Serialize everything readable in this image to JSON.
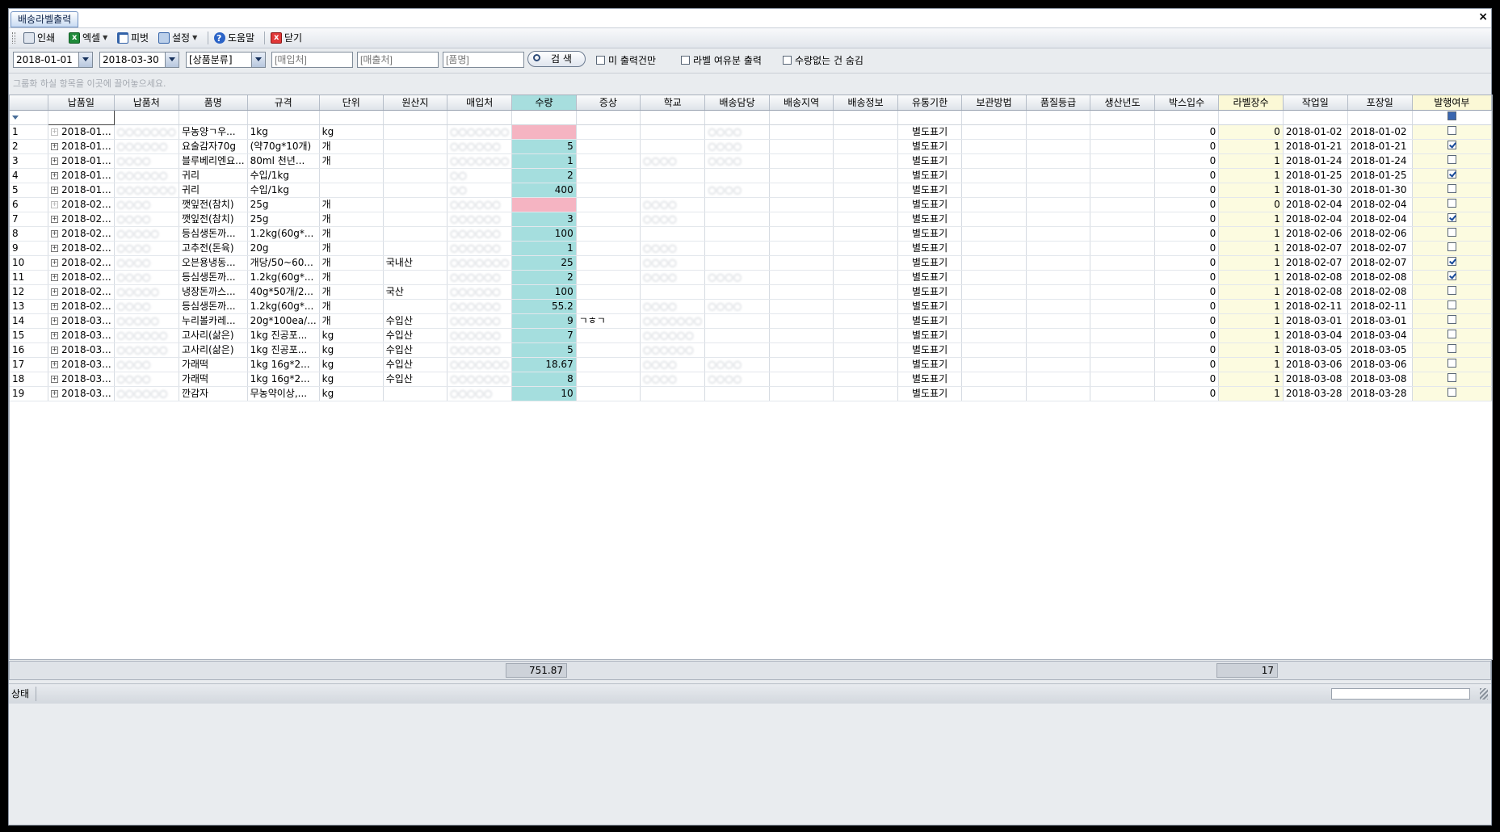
{
  "window": {
    "tab_title": "배송라벨출력",
    "close_glyph": "×"
  },
  "toolbar": {
    "print": "인쇄",
    "excel": "엑셀",
    "pivot": "피벗",
    "settings": "설정",
    "help": "도움말",
    "close": "닫기"
  },
  "filters": {
    "date_from": "2018-01-01",
    "date_to": "2018-03-30",
    "category": "[상품분류]",
    "supplier_placeholder": "[매입처]",
    "customer_placeholder": "[매출처]",
    "item_placeholder": "[품명]",
    "search_label": "검  색",
    "unprinted_only": {
      "label": "미 출력건만",
      "checked": false
    },
    "surplus_print": {
      "label": "라벨 여유분 출력",
      "checked": false
    },
    "hide_no_qty": {
      "label": "수량없는 건 숨김",
      "checked": false
    }
  },
  "group_panel_hint": "그룹화 하실 항목을 이곳에 끌어놓으세요.",
  "grid": {
    "columns": [
      "",
      "납품일",
      "납품처",
      "품명",
      "규격",
      "단위",
      "원산지",
      "매입처",
      "수량",
      "증상",
      "학교",
      "배송담당",
      "배송지역",
      "배송정보",
      "유통기한",
      "보관방법",
      "품질등급",
      "생산년도",
      "박스입수",
      "라벨장수",
      "작업일",
      "포장일",
      "발행여부"
    ],
    "rows": [
      {
        "n": "1",
        "date": "2018-01...",
        "cust": "○○○○○○○",
        "item": "무농양ㄱ우...",
        "spec": "1kg",
        "unit": "kg",
        "origin": "",
        "supplier": "○○○○○○○",
        "qty": "",
        "sym": "",
        "school": "",
        "mgr": "○○○○",
        "area": "",
        "info": "",
        "exp": "별도표기",
        "store": "",
        "grade": "",
        "year": "",
        "box": "0",
        "labels": "0",
        "work": "2018-01-02",
        "pack": "2018-01-02",
        "issued": false,
        "faint": true
      },
      {
        "n": "2",
        "date": "2018-01...",
        "cust": "○○○○○○",
        "item": "요술감자70g",
        "spec": "(약70g*10개)",
        "unit": "개",
        "origin": "",
        "supplier": "○○○○○○",
        "qty": "5",
        "sym": "",
        "school": "",
        "mgr": "○○○○",
        "area": "",
        "info": "",
        "exp": "별도표기",
        "store": "",
        "grade": "",
        "year": "",
        "box": "0",
        "labels": "1",
        "work": "2018-01-21",
        "pack": "2018-01-21",
        "issued": true,
        "faint": false
      },
      {
        "n": "3",
        "date": "2018-01...",
        "cust": "○○○○",
        "item": "블루베리엔요...",
        "spec": "80ml 천년...",
        "unit": "개",
        "origin": "",
        "supplier": "○○○○○○○",
        "qty": "1",
        "sym": "",
        "school": "○○○○",
        "mgr": "○○○○",
        "area": "",
        "info": "",
        "exp": "별도표기",
        "store": "",
        "grade": "",
        "year": "",
        "box": "0",
        "labels": "1",
        "work": "2018-01-24",
        "pack": "2018-01-24",
        "issued": false,
        "faint": false
      },
      {
        "n": "4",
        "date": "2018-01...",
        "cust": "○○○○○○",
        "item": "귀리",
        "spec": "수입/1kg",
        "unit": "",
        "origin": "",
        "supplier": "○○",
        "qty": "2",
        "sym": "",
        "school": "",
        "mgr": "",
        "area": "",
        "info": "",
        "exp": "별도표기",
        "store": "",
        "grade": "",
        "year": "",
        "box": "0",
        "labels": "1",
        "work": "2018-01-25",
        "pack": "2018-01-25",
        "issued": true,
        "faint": false
      },
      {
        "n": "5",
        "date": "2018-01...",
        "cust": "○○○○○○○",
        "item": "귀리",
        "spec": "수입/1kg",
        "unit": "",
        "origin": "",
        "supplier": "○○",
        "qty": "400",
        "sym": "",
        "school": "",
        "mgr": "○○○○",
        "area": "",
        "info": "",
        "exp": "별도표기",
        "store": "",
        "grade": "",
        "year": "",
        "box": "0",
        "labels": "1",
        "work": "2018-01-30",
        "pack": "2018-01-30",
        "issued": false,
        "faint": false
      },
      {
        "n": "6",
        "date": "2018-02...",
        "cust": "○○○○",
        "item": "깻잎전(참치)",
        "spec": "25g",
        "unit": "개",
        "origin": "",
        "supplier": "○○○○○○",
        "qty": "",
        "sym": "",
        "school": "○○○○",
        "mgr": "",
        "area": "",
        "info": "",
        "exp": "별도표기",
        "store": "",
        "grade": "",
        "year": "",
        "box": "0",
        "labels": "0",
        "work": "2018-02-04",
        "pack": "2018-02-04",
        "issued": false,
        "faint": true
      },
      {
        "n": "7",
        "date": "2018-02...",
        "cust": "○○○○",
        "item": "깻잎전(참치)",
        "spec": "25g",
        "unit": "개",
        "origin": "",
        "supplier": "○○○○○○",
        "qty": "3",
        "sym": "",
        "school": "○○○○",
        "mgr": "",
        "area": "",
        "info": "",
        "exp": "별도표기",
        "store": "",
        "grade": "",
        "year": "",
        "box": "0",
        "labels": "1",
        "work": "2018-02-04",
        "pack": "2018-02-04",
        "issued": true,
        "faint": false
      },
      {
        "n": "8",
        "date": "2018-02...",
        "cust": "○○○○○",
        "item": "등심생돈까...",
        "spec": "1.2kg(60g*...",
        "unit": "개",
        "origin": "",
        "supplier": "○○○○○○",
        "qty": "100",
        "sym": "",
        "school": "",
        "mgr": "",
        "area": "",
        "info": "",
        "exp": "별도표기",
        "store": "",
        "grade": "",
        "year": "",
        "box": "0",
        "labels": "1",
        "work": "2018-02-06",
        "pack": "2018-02-06",
        "issued": false,
        "faint": false
      },
      {
        "n": "9",
        "date": "2018-02...",
        "cust": "○○○○",
        "item": "고추전(돈육)",
        "spec": "20g",
        "unit": "개",
        "origin": "",
        "supplier": "○○○○○○",
        "qty": "1",
        "sym": "",
        "school": "○○○○",
        "mgr": "",
        "area": "",
        "info": "",
        "exp": "별도표기",
        "store": "",
        "grade": "",
        "year": "",
        "box": "0",
        "labels": "1",
        "work": "2018-02-07",
        "pack": "2018-02-07",
        "issued": false,
        "faint": false
      },
      {
        "n": "10",
        "date": "2018-02...",
        "cust": "○○○○",
        "item": "오븐용냉동...",
        "spec": "개당/50~60...",
        "unit": "개",
        "origin": "국내산",
        "supplier": "○○○○○○○",
        "qty": "25",
        "sym": "",
        "school": "○○○○",
        "mgr": "",
        "area": "",
        "info": "",
        "exp": "별도표기",
        "store": "",
        "grade": "",
        "year": "",
        "box": "0",
        "labels": "1",
        "work": "2018-02-07",
        "pack": "2018-02-07",
        "issued": true,
        "faint": false
      },
      {
        "n": "11",
        "date": "2018-02...",
        "cust": "○○○○",
        "item": "등심생돈까...",
        "spec": "1.2kg(60g*...",
        "unit": "개",
        "origin": "",
        "supplier": "○○○○○○",
        "qty": "2",
        "sym": "",
        "school": "○○○○",
        "mgr": "○○○○",
        "area": "",
        "info": "",
        "exp": "별도표기",
        "store": "",
        "grade": "",
        "year": "",
        "box": "0",
        "labels": "1",
        "work": "2018-02-08",
        "pack": "2018-02-08",
        "issued": true,
        "faint": false
      },
      {
        "n": "12",
        "date": "2018-02...",
        "cust": "○○○○○",
        "item": "냉장돈까스...",
        "spec": "40g*50개/2...",
        "unit": "개",
        "origin": "국산",
        "supplier": "○○○○○○",
        "qty": "100",
        "sym": "",
        "school": "",
        "mgr": "",
        "area": "",
        "info": "",
        "exp": "별도표기",
        "store": "",
        "grade": "",
        "year": "",
        "box": "0",
        "labels": "1",
        "work": "2018-02-08",
        "pack": "2018-02-08",
        "issued": false,
        "faint": false
      },
      {
        "n": "13",
        "date": "2018-02...",
        "cust": "○○○○",
        "item": "등심생돈까...",
        "spec": "1.2kg(60g*...",
        "unit": "개",
        "origin": "",
        "supplier": "○○○○○○",
        "qty": "55.2",
        "sym": "",
        "school": "○○○○",
        "mgr": "○○○○",
        "area": "",
        "info": "",
        "exp": "별도표기",
        "store": "",
        "grade": "",
        "year": "",
        "box": "0",
        "labels": "1",
        "work": "2018-02-11",
        "pack": "2018-02-11",
        "issued": false,
        "faint": false
      },
      {
        "n": "14",
        "date": "2018-03...",
        "cust": "○○○○○",
        "item": "누리볼카레...",
        "spec": "20g*100ea/...",
        "unit": "개",
        "origin": "수입산",
        "supplier": "○○○○○○",
        "qty": "9",
        "sym": "ㄱㅎㄱ",
        "school": "○○○○○○○",
        "mgr": "",
        "area": "",
        "info": "",
        "exp": "별도표기",
        "store": "",
        "grade": "",
        "year": "",
        "box": "0",
        "labels": "1",
        "work": "2018-03-01",
        "pack": "2018-03-01",
        "issued": false,
        "faint": false
      },
      {
        "n": "15",
        "date": "2018-03...",
        "cust": "○○○○○○",
        "item": "고사리(삶은)",
        "spec": "1kg 진공포...",
        "unit": "kg",
        "origin": "수입산",
        "supplier": "○○○○○○",
        "qty": "7",
        "sym": "",
        "school": "○○○○○○",
        "mgr": "",
        "area": "",
        "info": "",
        "exp": "별도표기",
        "store": "",
        "grade": "",
        "year": "",
        "box": "0",
        "labels": "1",
        "work": "2018-03-04",
        "pack": "2018-03-04",
        "issued": false,
        "faint": false
      },
      {
        "n": "16",
        "date": "2018-03...",
        "cust": "○○○○○○",
        "item": "고사리(삶은)",
        "spec": "1kg 진공포...",
        "unit": "kg",
        "origin": "수입산",
        "supplier": "○○○○○○",
        "qty": "5",
        "sym": "",
        "school": "○○○○○○",
        "mgr": "",
        "area": "",
        "info": "",
        "exp": "별도표기",
        "store": "",
        "grade": "",
        "year": "",
        "box": "0",
        "labels": "1",
        "work": "2018-03-05",
        "pack": "2018-03-05",
        "issued": false,
        "faint": false
      },
      {
        "n": "17",
        "date": "2018-03...",
        "cust": "○○○○",
        "item": "가래떡",
        "spec": "1kg 16g*2...",
        "unit": "kg",
        "origin": "수입산",
        "supplier": "○○○○○○○",
        "qty": "18.67",
        "sym": "",
        "school": "○○○○",
        "mgr": "○○○○",
        "area": "",
        "info": "",
        "exp": "별도표기",
        "store": "",
        "grade": "",
        "year": "",
        "box": "0",
        "labels": "1",
        "work": "2018-03-06",
        "pack": "2018-03-06",
        "issued": false,
        "faint": false
      },
      {
        "n": "18",
        "date": "2018-03...",
        "cust": "○○○○",
        "item": "가래떡",
        "spec": "1kg 16g*2...",
        "unit": "kg",
        "origin": "수입산",
        "supplier": "○○○○○○○",
        "qty": "8",
        "sym": "",
        "school": "○○○○",
        "mgr": "○○○○",
        "area": "",
        "info": "",
        "exp": "별도표기",
        "store": "",
        "grade": "",
        "year": "",
        "box": "0",
        "labels": "1",
        "work": "2018-03-08",
        "pack": "2018-03-08",
        "issued": false,
        "faint": false
      },
      {
        "n": "19",
        "date": "2018-03...",
        "cust": "○○○○○○",
        "item": "깐감자",
        "spec": "무농약이상,...",
        "unit": "kg",
        "origin": "",
        "supplier": "○○○○○",
        "qty": "10",
        "sym": "",
        "school": "",
        "mgr": "",
        "area": "",
        "info": "",
        "exp": "별도표기",
        "store": "",
        "grade": "",
        "year": "",
        "box": "0",
        "labels": "1",
        "work": "2018-03-28",
        "pack": "2018-03-28",
        "issued": false,
        "faint": false
      }
    ]
  },
  "summary": {
    "qty_total": "751.87",
    "label_total": "17"
  },
  "status": {
    "label": "상태"
  },
  "colors": {
    "qty_fill": "#a5dede",
    "qty_empty_fill": "#f5b4c2",
    "label_fill": "#fcfbe0",
    "tab_accent": "#6d8fc0"
  }
}
